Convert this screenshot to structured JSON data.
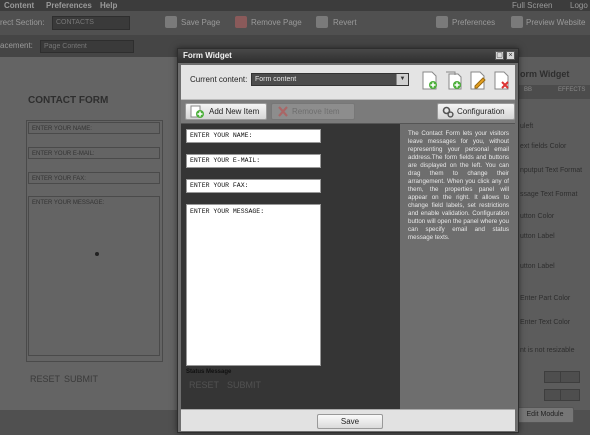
{
  "menubar": {
    "items": [
      "Content",
      "Preferences",
      "Help"
    ],
    "full_screen": "Full Screen",
    "logout": "Logo"
  },
  "toolbar": {
    "direct_section_label": "rect Section:",
    "direct_section_value": "CONTACTS",
    "save_page": "Save Page",
    "remove_page": "Remove Page",
    "revert": "Revert",
    "preferences": "Preferences",
    "preview_website": "Preview Website",
    "placement_label": "acement:",
    "placement_value": "Page Content"
  },
  "background_page": {
    "title": "CONTACT FORM",
    "fields": [
      "ENTER YOUR NAME:",
      "ENTER YOUR E-MAIL:",
      "ENTER YOUR FAX:"
    ],
    "message_label": "ENTER YOUR MESSAGE:",
    "reset": "RESET",
    "submit": "SUBMIT"
  },
  "side_panel": {
    "title": "orm Widget",
    "tabs": [
      "BB",
      "EFFECTS"
    ],
    "items": [
      "uleft",
      "ext fields Color",
      "nputput Text Format",
      "ssage Text Format",
      "utton Color",
      "utton Label",
      "utton Label",
      "Enter Part Color",
      "Enter Text Color",
      "nt is not resizable"
    ],
    "edit_module": "Edit Module"
  },
  "dialog": {
    "title": "Form Widget",
    "current_content_label": "Current content:",
    "current_content_value": "Form content",
    "add_new_item": "Add New Item",
    "remove_item": "Remove Item",
    "configuration": "Configuration",
    "fields": [
      "ENTER YOUR NAME:",
      "ENTER YOUR E-MAIL:",
      "ENTER YOUR FAX:"
    ],
    "message_label": "ENTER YOUR MESSAGE:",
    "status_message": "Status Message",
    "description": "The Contact Form lets your visitors leave messages for you, without representing your personal email address.The form fields and buttons are displayed on the left. You can drag them to change their arrangement. When you click any of them, the properties panel will appear on the right. It allows to change field labels, set restrictions and enable validation. Configuration button will open the panel where you can specify email and status message texts.",
    "save": "Save"
  }
}
